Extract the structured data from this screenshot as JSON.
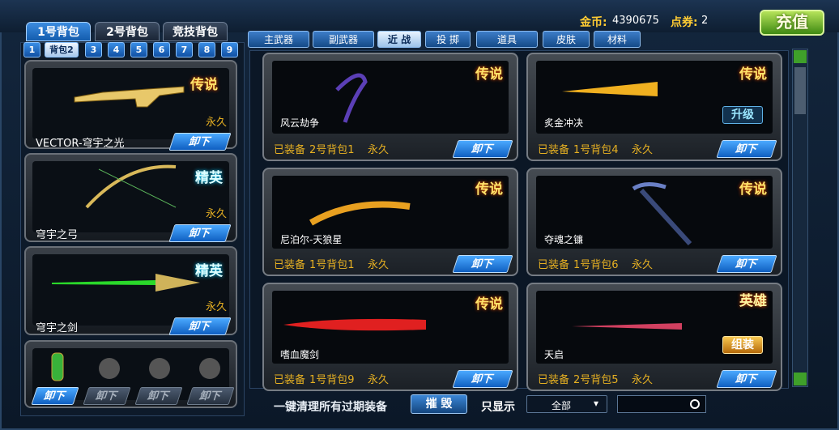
{
  "header": {
    "gold_label": "金币:",
    "gold_value": "4390675",
    "points_label": "点券:",
    "points_value": "2",
    "recharge": "充值"
  },
  "bag_tabs": [
    "1号背包",
    "2号背包",
    "竞技背包"
  ],
  "bag_numbers": [
    "1",
    "背包2",
    "3",
    "4",
    "5",
    "6",
    "7",
    "8",
    "9"
  ],
  "categories": [
    "主武器",
    "副武器",
    "近 战",
    "投 掷",
    "道具",
    "皮肤",
    "材料"
  ],
  "left_slots": [
    {
      "name": "VECTOR-穹宇之光",
      "duration": "永久",
      "badge": "传说",
      "button": "卸下"
    },
    {
      "name": "穹宇之弓",
      "duration": "永久",
      "badge": "精英",
      "button": "卸下"
    },
    {
      "name": "穹宇之剑",
      "duration": "永久",
      "badge": "精英",
      "button": "卸下"
    }
  ],
  "grenade_buttons": [
    "卸下",
    "卸下",
    "卸下",
    "卸下"
  ],
  "items": [
    {
      "name": "风云劫争",
      "status": "已装备",
      "bag": "2号背包1",
      "duration": "永久",
      "badge": "传说",
      "button": "卸下"
    },
    {
      "name": "炙金冲决",
      "status": "已装备",
      "bag": "1号背包4",
      "duration": "永久",
      "badge": "传说",
      "button": "卸下",
      "extra": "升级"
    },
    {
      "name": "尼泊尔-天狼星",
      "status": "已装备",
      "bag": "1号背包1",
      "duration": "永久",
      "badge": "传说",
      "button": "卸下"
    },
    {
      "name": "夺魂之镰",
      "status": "已装备",
      "bag": "1号背包6",
      "duration": "永久",
      "badge": "传说",
      "button": "卸下"
    },
    {
      "name": "嗜血魔剑",
      "status": "已装备",
      "bag": "1号背包9",
      "duration": "永久",
      "badge": "传说",
      "button": "卸下"
    },
    {
      "name": "天启",
      "status": "已装备",
      "bag": "2号背包5",
      "duration": "永久",
      "badge": "英雄",
      "button": "卸下",
      "extra": "组装"
    }
  ],
  "bottom": {
    "clean_label": "一键清理所有过期装备",
    "destroy": "摧 毁",
    "show_label": "只显示",
    "filter_value": "全部"
  }
}
